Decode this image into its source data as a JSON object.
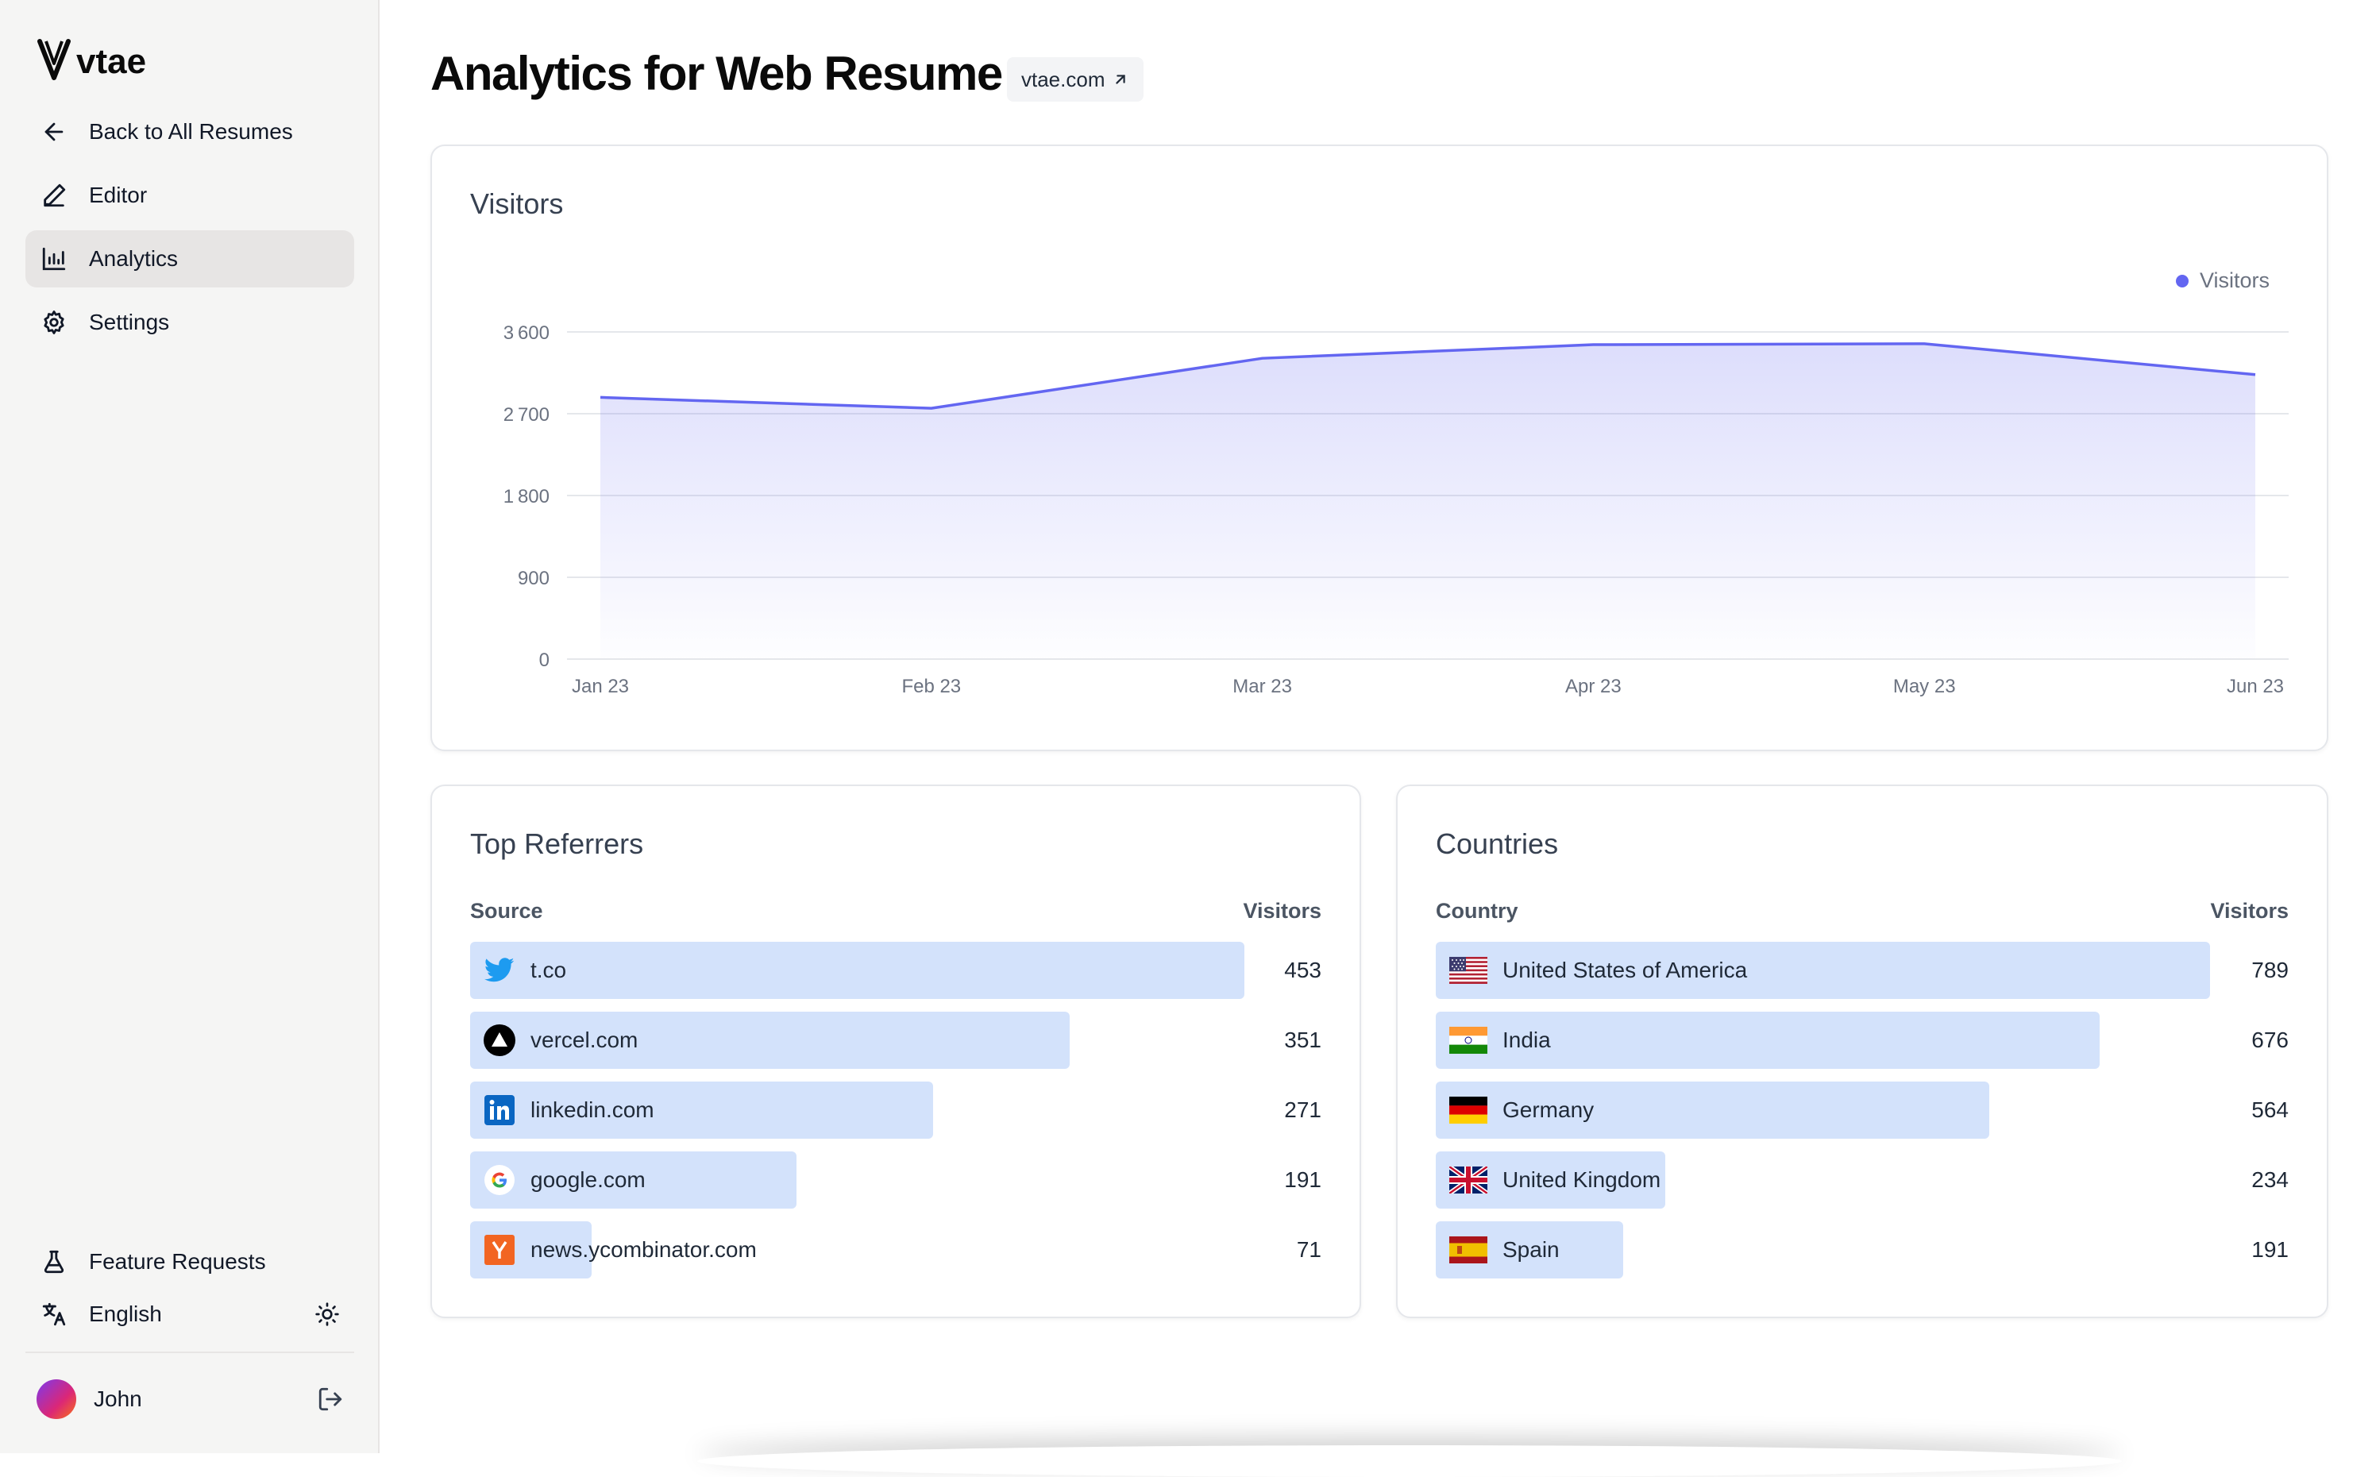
{
  "sidebar": {
    "logo_text": "vtae",
    "nav": [
      {
        "label": "Back to All Resumes",
        "icon": "arrow-left-icon"
      },
      {
        "label": "Editor",
        "icon": "pencil-icon"
      },
      {
        "label": "Analytics",
        "icon": "bar-chart-icon",
        "active": true
      },
      {
        "label": "Settings",
        "icon": "gear-icon"
      }
    ],
    "feature_requests": "Feature Requests",
    "language": "English",
    "user_name": "John"
  },
  "header": {
    "title": "Analytics for Web Resume",
    "domain": "vtae.com"
  },
  "visitors_card": {
    "title": "Visitors",
    "legend": "Visitors"
  },
  "chart_data": {
    "type": "area",
    "title": "Visitors",
    "x": [
      "Jan 23",
      "Feb 23",
      "Mar 23",
      "Apr 23",
      "May 23",
      "Jun 23"
    ],
    "series": [
      {
        "name": "Visitors",
        "values": [
          2880,
          2760,
          3310,
          3460,
          3470,
          3130
        ]
      }
    ],
    "yticks": [
      "0",
      "900",
      "1800",
      "2700",
      "3600"
    ],
    "ylim": [
      0,
      3600
    ],
    "grid": true,
    "legend_position": "top-right",
    "color": "#6366f1"
  },
  "referrers": {
    "title": "Top Referrers",
    "col_source": "Source",
    "col_visitors": "Visitors",
    "rows": [
      {
        "label": "t.co",
        "value": "453",
        "icon": "twitter-icon"
      },
      {
        "label": "vercel.com",
        "value": "351",
        "icon": "vercel-icon"
      },
      {
        "label": "linkedin.com",
        "value": "271",
        "icon": "linkedin-icon"
      },
      {
        "label": "google.com",
        "value": "191",
        "icon": "google-icon"
      },
      {
        "label": "news.ycombinator.com",
        "value": "71",
        "icon": "ycombinator-icon"
      }
    ]
  },
  "countries": {
    "title": "Countries",
    "col_country": "Country",
    "col_visitors": "Visitors",
    "rows": [
      {
        "label": "United States of America",
        "value": "789",
        "icon": "us-flag-icon"
      },
      {
        "label": "India",
        "value": "676",
        "icon": "india-flag-icon"
      },
      {
        "label": "Germany",
        "value": "564",
        "icon": "germany-flag-icon"
      },
      {
        "label": "United Kingdom",
        "value": "234",
        "icon": "uk-flag-icon"
      },
      {
        "label": "Spain",
        "value": "191",
        "icon": "spain-flag-icon"
      }
    ]
  },
  "colors": {
    "accent": "#6366f1",
    "bar_fill": "#d3e2fb",
    "sidebar_bg": "#f5f5f4",
    "active_nav_bg": "#e7e5e4"
  }
}
